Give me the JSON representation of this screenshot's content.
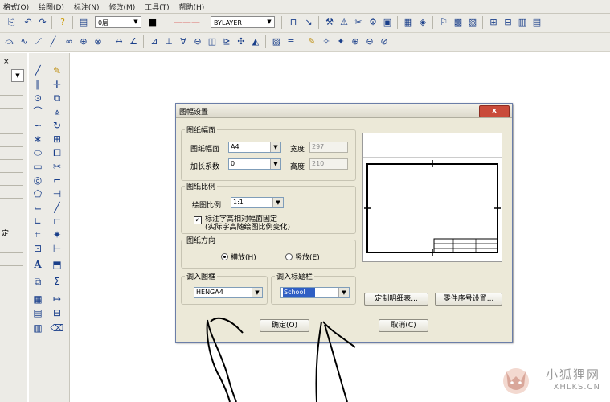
{
  "menu": [
    "格式(O)",
    "绘图(D)",
    "标注(N)",
    "修改(M)",
    "工具(T)",
    "帮助(H)"
  ],
  "toolbar": {
    "layer_combo": "0层",
    "linetype_combo": "BYLAYER"
  },
  "dialog": {
    "title": "图幅设置",
    "close_label": "x",
    "sheet_group": {
      "legend": "图纸幅面",
      "size_label": "图纸幅面",
      "size_value": "A4",
      "width_label": "宽度",
      "width_value": "297",
      "factor_label": "加长系数",
      "factor_value": "0",
      "height_label": "高度",
      "height_value": "210"
    },
    "scale_group": {
      "legend": "图纸比例",
      "ratio_label": "绘图比例",
      "ratio_value": "1:1",
      "fixed_text_label": "标注字高相对幅面固定",
      "fixed_text_sub": "(实际字高随绘图比例变化)",
      "fixed_text_checked": true
    },
    "orient_group": {
      "legend": "图纸方向",
      "landscape_label": "横放(H)",
      "portrait_label": "竖放(E)",
      "selected": "landscape"
    },
    "frame_group": {
      "legend": "调入图框",
      "value": "HENGA4"
    },
    "title_group": {
      "legend": "调入标题栏",
      "value": "School"
    },
    "buttons": {
      "detail": "定制明细表...",
      "part_number": "零件序号设置...",
      "ok": "确定(O)",
      "cancel": "取消(C)"
    }
  },
  "left_panel": {
    "label": "定"
  },
  "watermark": {
    "text": "小狐狸网",
    "url": "XHLKS.CN"
  },
  "colors": {
    "title_select_bg": "#2f5fc4",
    "close_button": "#c94b3a"
  }
}
